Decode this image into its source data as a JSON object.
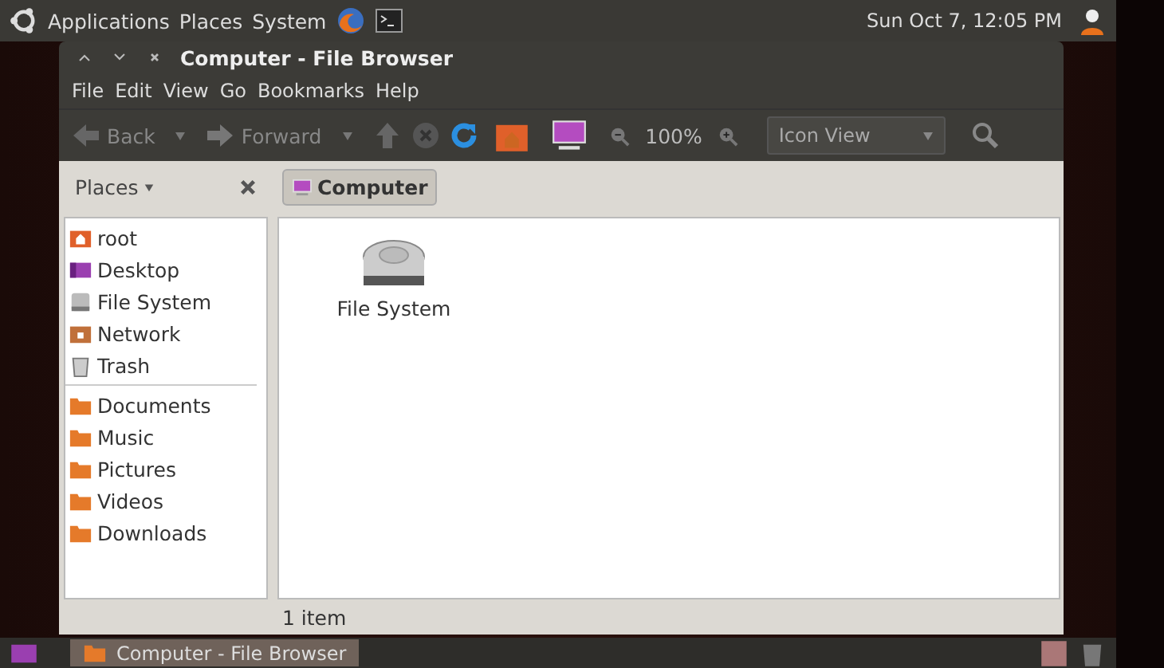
{
  "top_panel": {
    "menus": [
      "Applications",
      "Places",
      "System"
    ],
    "clock": "Sun Oct  7, 12:05 PM"
  },
  "window": {
    "title": "Computer - File Browser",
    "menu": [
      "File",
      "Edit",
      "View",
      "Go",
      "Bookmarks",
      "Help"
    ],
    "toolbar": {
      "back": "Back",
      "forward": "Forward",
      "zoom": "100%",
      "view": "Icon View"
    },
    "location": {
      "places_label": "Places",
      "path": [
        {
          "label": "Computer",
          "selected": true
        }
      ]
    },
    "sidebar": {
      "places": [
        {
          "label": "root",
          "kind": "home"
        },
        {
          "label": "Desktop",
          "kind": "desktop"
        },
        {
          "label": "File System",
          "kind": "drive"
        },
        {
          "label": "Network",
          "kind": "network"
        },
        {
          "label": "Trash",
          "kind": "trash"
        }
      ],
      "bookmarks": [
        {
          "label": "Documents",
          "kind": "folder"
        },
        {
          "label": "Music",
          "kind": "folder"
        },
        {
          "label": "Pictures",
          "kind": "folder"
        },
        {
          "label": "Videos",
          "kind": "folder"
        },
        {
          "label": "Downloads",
          "kind": "folder"
        }
      ]
    },
    "items": [
      {
        "label": "File System",
        "kind": "drive"
      }
    ],
    "status": "1 item"
  },
  "taskbar": {
    "tasks": [
      {
        "label": "Computer - File Browser",
        "selected": true
      }
    ]
  }
}
